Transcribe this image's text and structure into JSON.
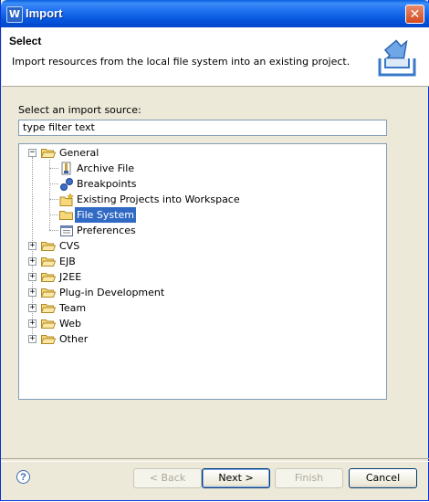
{
  "window": {
    "title": "Import",
    "app_icon": "W",
    "close_glyph": "✕"
  },
  "header": {
    "title": "Select",
    "description": "Import resources from the local file system into an existing project."
  },
  "main": {
    "source_label": "Select an import source:",
    "filter_value": "type filter text",
    "tree": [
      {
        "label": "General",
        "expanded": true,
        "children": [
          {
            "label": "Archive File",
            "icon": "archive-file-icon"
          },
          {
            "label": "Breakpoints",
            "icon": "breakpoints-icon"
          },
          {
            "label": "Existing Projects into Workspace",
            "icon": "existing-projects-icon"
          },
          {
            "label": "File System",
            "icon": "folder-icon",
            "selected": true
          },
          {
            "label": "Preferences",
            "icon": "preferences-icon"
          }
        ]
      },
      {
        "label": "CVS",
        "expanded": false
      },
      {
        "label": "EJB",
        "expanded": false
      },
      {
        "label": "J2EE",
        "expanded": false
      },
      {
        "label": "Plug-in Development",
        "expanded": false
      },
      {
        "label": "Team",
        "expanded": false
      },
      {
        "label": "Web",
        "expanded": false
      },
      {
        "label": "Other",
        "expanded": false
      }
    ]
  },
  "footer": {
    "help_glyph": "?",
    "back_label": "< Back",
    "next_label": "Next >",
    "finish_label": "Finish",
    "cancel_label": "Cancel"
  },
  "colors": {
    "selection": "#316ac5",
    "titlebar": "#0454dc",
    "dialog_bg": "#ece9d8"
  }
}
